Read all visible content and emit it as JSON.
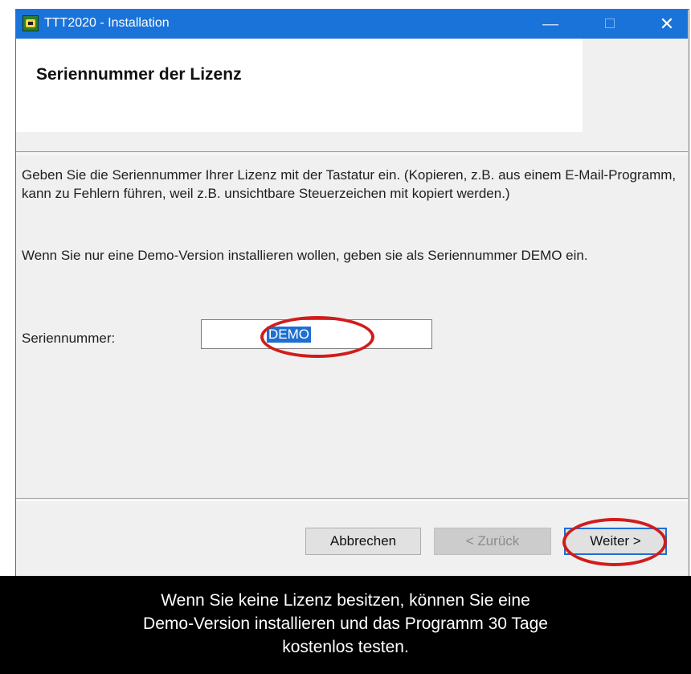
{
  "window": {
    "title": "TTT2020 - Installation",
    "controls": {
      "minimize": "—",
      "close": "✕"
    }
  },
  "header": {
    "title": "Seriennummer der Lizenz"
  },
  "instructions": {
    "para1": "Geben Sie die Seriennummer Ihrer Lizenz mit der Tastatur ein. (Kopieren, z.B. aus einem E-Mail-Programm, kann zu Fehlern führen, weil z.B. unsichtbare Steuerzeichen mit kopiert werden.)",
    "para2": "Wenn Sie nur eine Demo-Version installieren wollen, geben sie als Seriennummer DEMO ein."
  },
  "serial": {
    "label": "Seriennummer:",
    "value": "DEMO"
  },
  "buttons": {
    "cancel": "Abbrechen",
    "back": "< Zurück",
    "next": "Weiter >"
  },
  "caption": {
    "line1": "Wenn Sie keine Lizenz besitzen, können Sie eine",
    "line2": "Demo-Version installieren und das Programm 30 Tage",
    "line3": "kostenlos testen."
  },
  "colors": {
    "titlebar": "#1a73d9",
    "annotation": "#d11c1c",
    "selection": "#1f6fd1"
  }
}
